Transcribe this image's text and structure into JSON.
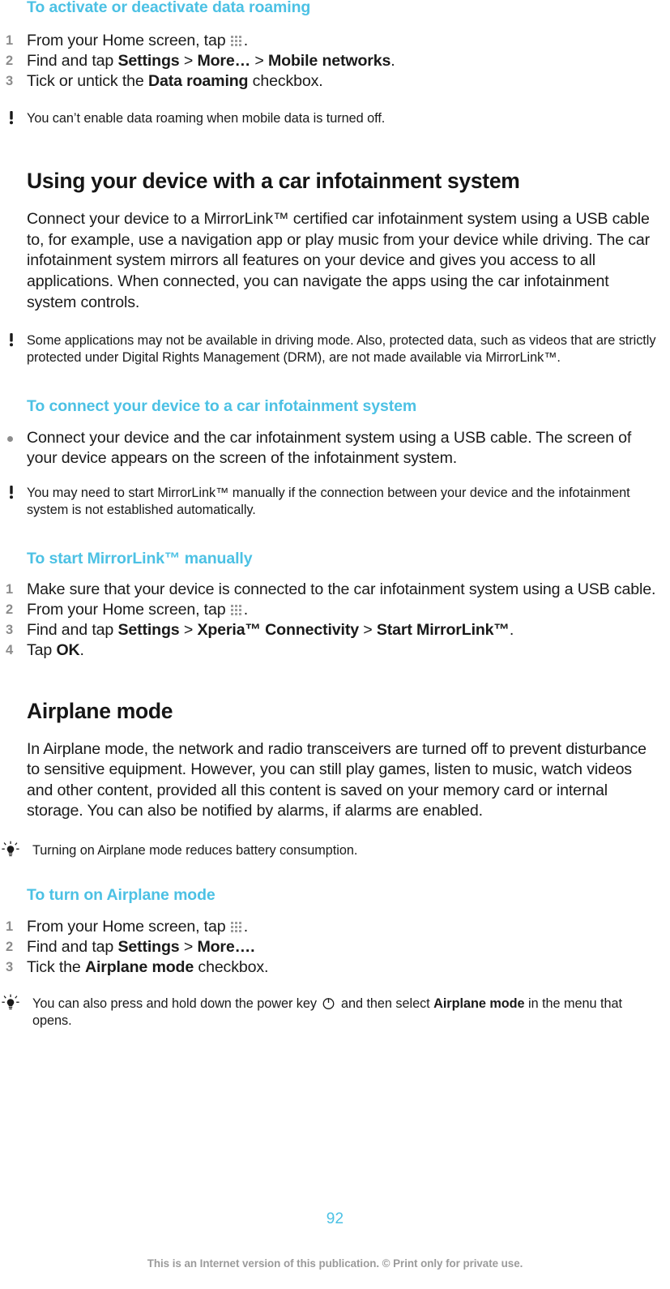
{
  "page": {
    "number": "92",
    "footer_note": "This is an Internet version of this publication. © Print only for private use.",
    "accent_color": "#4cc1e4",
    "text_color": "#1a1a1a",
    "muted_color": "#8c8c8c"
  },
  "sections": {
    "data_roaming": {
      "heading": "To activate or deactivate data roaming",
      "steps": [
        {
          "num": "1",
          "pre": "From your Home screen, tap ",
          "icon": "launcher-icon",
          "post": "."
        },
        {
          "num": "2",
          "pre": "Find and tap ",
          "bold1": "Settings",
          "sep1": " > ",
          "bold2": "More…",
          "sep2": " > ",
          "bold3": "Mobile networks",
          "post": "."
        },
        {
          "num": "3",
          "pre": "Tick or untick the ",
          "bold1": "Data roaming",
          "post": " checkbox."
        }
      ],
      "note": {
        "icon": "warning-icon",
        "text": "You can’t enable data roaming when mobile data is turned off."
      }
    },
    "car_infotainment": {
      "heading": "Using your device with a car infotainment system",
      "body": "Connect your device to a MirrorLink™ certified car infotainment system using a USB cable to, for example, use a navigation app or play music from your device while driving. The car infotainment system mirrors all features on your device and gives you access to all applications. When connected, you can navigate the apps using the car infotainment system controls.",
      "note": {
        "icon": "warning-icon",
        "text": "Some applications may not be available in driving mode. Also, protected data, such as videos that are strictly protected under Digital Rights Management (DRM), are not made available via MirrorLink™."
      }
    },
    "connect_car": {
      "heading": "To connect your device to a car infotainment system",
      "bullet": "Connect your device and the car infotainment system using a USB cable. The screen of your device appears on the screen of the infotainment system.",
      "note": {
        "icon": "warning-icon",
        "text": "You may need to start MirrorLink™ manually if the connection between your device and the infotainment system is not established automatically."
      }
    },
    "start_mirrorlink": {
      "heading": "To start MirrorLink™ manually",
      "steps": [
        {
          "num": "1",
          "pre": "Make sure that your device is connected to the car infotainment system using a USB cable."
        },
        {
          "num": "2",
          "pre": "From your Home screen, tap ",
          "icon": "launcher-icon",
          "post": "."
        },
        {
          "num": "3",
          "pre": "Find and tap ",
          "bold1": "Settings",
          "sep1": " > ",
          "bold2": "Xperia™ Connectivity",
          "sep2": " > ",
          "bold3": "Start MirrorLink™",
          "post": "."
        },
        {
          "num": "4",
          "pre": "Tap ",
          "bold1": "OK",
          "post": "."
        }
      ]
    },
    "airplane_mode": {
      "heading": "Airplane mode",
      "body": "In Airplane mode, the network and radio transceivers are turned off to prevent disturbance to sensitive equipment. However, you can still play games, listen to music, watch videos and other content, provided all this content is saved on your memory card or internal storage. You can also be notified by alarms, if alarms are enabled.",
      "tip": {
        "icon": "lightbulb-icon",
        "text": "Turning on Airplane mode reduces battery consumption."
      }
    },
    "turn_on_airplane": {
      "heading": "To turn on Airplane mode",
      "steps": [
        {
          "num": "1",
          "pre": "From your Home screen, tap ",
          "icon": "launcher-icon",
          "post": "."
        },
        {
          "num": "2",
          "pre": "Find and tap ",
          "bold1": "Settings",
          "sep1": " > ",
          "bold2": "More….",
          "post": ""
        },
        {
          "num": "3",
          "pre": "Tick the ",
          "bold1": "Airplane mode",
          "post": " checkbox."
        }
      ],
      "tip": {
        "icon": "lightbulb-icon",
        "pre": "You can also press and hold down the power key ",
        "icon_inline": "power-icon",
        "mid": " and then select ",
        "bold1": "Airplane mode",
        "post": " in the menu that opens."
      }
    }
  }
}
